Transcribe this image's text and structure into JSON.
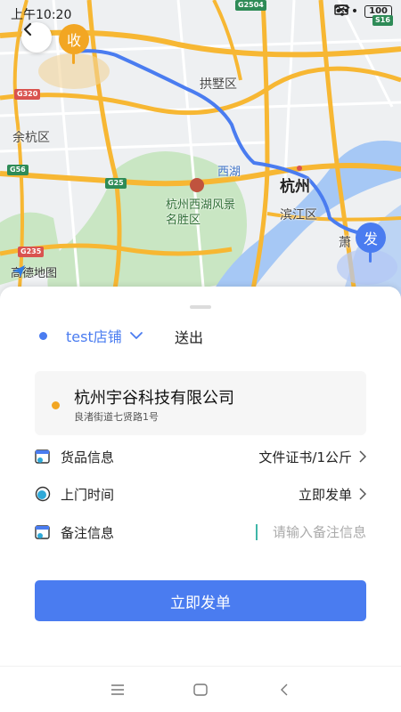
{
  "status_bar": {
    "time": "上午10:20",
    "dots": "•••",
    "battery": "100"
  },
  "map": {
    "pins": {
      "receive": "收",
      "send": "发"
    },
    "labels": {
      "gongshu": "拱墅区",
      "yuhang": "余杭区",
      "hangzhou": "杭州",
      "xihu": "西湖",
      "binjiang": "滨江区",
      "xiao": "萧",
      "scenic": "杭州西湖风景名胜区"
    },
    "road_shields": [
      "G320",
      "G56",
      "G25",
      "G235",
      "G2504",
      "S16"
    ],
    "brand": "高德地图",
    "colors": {
      "route": "#4a7cf0",
      "road_major": "#f7b733",
      "road_minor": "#ffffff",
      "water": "#a6c8f5",
      "park": "#c9e6c3",
      "land": "#eef0f2"
    }
  },
  "sender": {
    "store_name": "test店铺",
    "action": "送出"
  },
  "address": {
    "title": "杭州宇谷科技有限公司",
    "detail": "良渚街道七贤路1号"
  },
  "rows": {
    "goods": {
      "label": "货品信息",
      "value": "文件证书/1公斤"
    },
    "time": {
      "label": "上门时间",
      "value": "立即发单"
    },
    "note": {
      "label": "备注信息",
      "placeholder": "请输入备注信息",
      "value": ""
    }
  },
  "submit_label": "立即发单",
  "colors": {
    "accent": "#4a7cf0",
    "receive_pin": "#f2a623"
  }
}
